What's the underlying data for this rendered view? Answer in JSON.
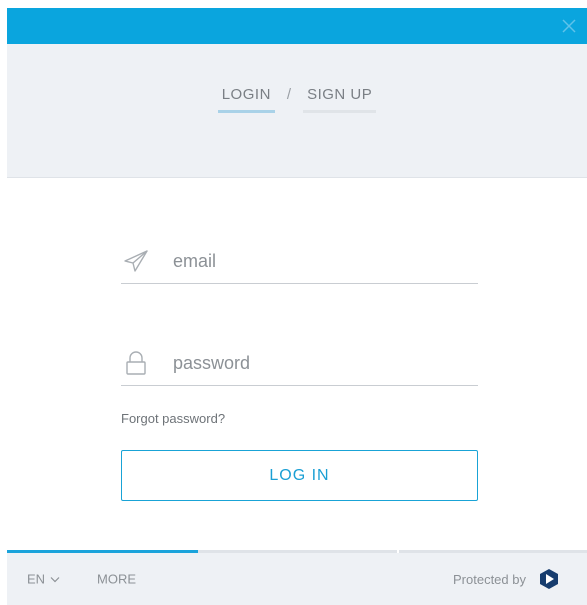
{
  "tabs": {
    "login": "LOGIN",
    "separator": "/",
    "signup": "SIGN UP",
    "active": "login"
  },
  "form": {
    "email_placeholder": "email",
    "password_placeholder": "password",
    "forgot_label": "Forgot password?",
    "submit_label": "LOG IN"
  },
  "footer": {
    "language": "EN",
    "more_label": "MORE",
    "protected_label": "Protected by",
    "progress_fraction": 0.33
  },
  "icons": {
    "close": "close-icon",
    "email": "paper-plane-icon",
    "password": "lock-icon",
    "language_caret": "chevron-down-icon",
    "protector_logo": "shield-logo-icon"
  },
  "colors": {
    "accent": "#0aa5de",
    "header_bg": "#eef1f5",
    "button_border": "#19a3d6",
    "progress_fill": "#1aa3db"
  }
}
